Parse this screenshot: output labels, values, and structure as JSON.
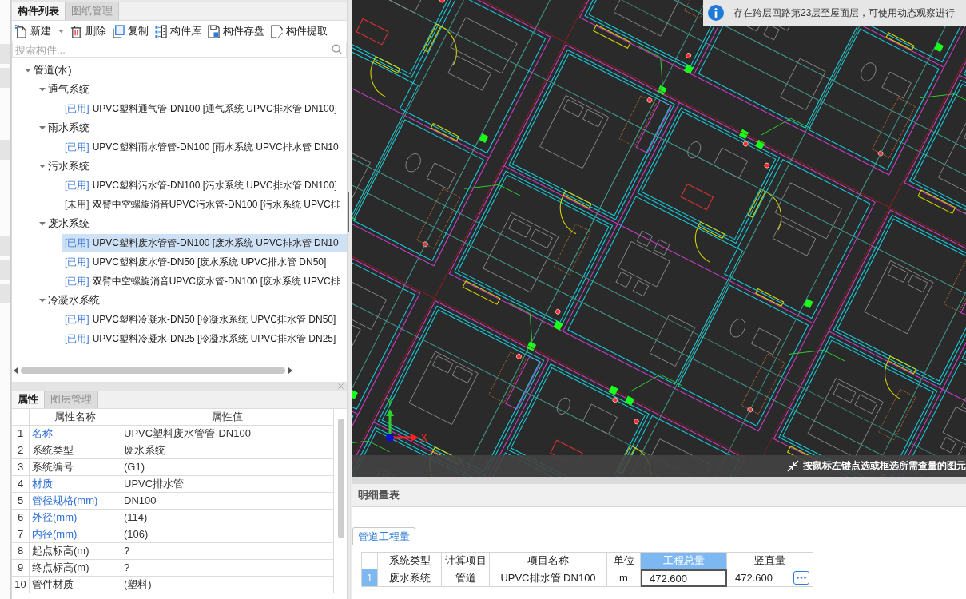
{
  "component_panel": {
    "tabs": [
      {
        "label": "构件列表",
        "selected": true
      },
      {
        "label": "图纸管理",
        "selected": false
      }
    ],
    "toolbar": [
      {
        "kind": "new",
        "label": "新建",
        "dropdown": true
      },
      {
        "kind": "delete",
        "label": "删除",
        "dropdown": false
      },
      {
        "kind": "copy",
        "label": "复制",
        "dropdown": false
      },
      {
        "kind": "library",
        "label": "构件库",
        "dropdown": false
      },
      {
        "kind": "save",
        "label": "构件存盘",
        "dropdown": false
      },
      {
        "kind": "extract",
        "label": "构件提取",
        "dropdown": false
      }
    ],
    "search": {
      "placeholder": "搜索构件..."
    },
    "tree": [
      {
        "kind": "folder",
        "label": "管道(水)",
        "expanded": true,
        "children": [
          {
            "kind": "folder",
            "label": "通气系统",
            "expanded": true,
            "children": [
              {
                "kind": "component",
                "tag": "[已用]",
                "used": true,
                "label": "UPVC塑料通气管-DN100 [通气系统 UPVC排水管 DN100]",
                "selected": false
              }
            ]
          },
          {
            "kind": "folder",
            "label": "雨水系统",
            "expanded": true,
            "children": [
              {
                "kind": "component",
                "tag": "[已用]",
                "used": true,
                "label": "UPVC塑料雨水管管-DN100 [雨水系统 UPVC排水管 DN10",
                "selected": false
              }
            ]
          },
          {
            "kind": "folder",
            "label": "污水系统",
            "expanded": true,
            "children": [
              {
                "kind": "component",
                "tag": "[已用]",
                "used": true,
                "label": "UPVC塑料污水管-DN100 [污水系统 UPVC排水管 DN100]",
                "selected": false
              },
              {
                "kind": "component",
                "tag": "[未用]",
                "used": false,
                "label": "双臂中空螺旋消音UPVC污水管-DN100 [污水系统 UPVC排",
                "selected": false
              }
            ]
          },
          {
            "kind": "folder",
            "label": "废水系统",
            "expanded": true,
            "children": [
              {
                "kind": "component",
                "tag": "[已用]",
                "used": true,
                "label": "UPVC塑料废水管管-DN100 [废水系统 UPVC排水管 DN10",
                "selected": true
              },
              {
                "kind": "component",
                "tag": "[已用]",
                "used": true,
                "label": "UPVC塑料废水管-DN50 [废水系统 UPVC排水管 DN50]",
                "selected": false
              },
              {
                "kind": "component",
                "tag": "[已用]",
                "used": true,
                "label": "双臂中空螺旋消音UPVC废水管-DN100 [废水系统 UPVC排",
                "selected": false
              }
            ]
          },
          {
            "kind": "folder",
            "label": "冷凝水系统",
            "expanded": true,
            "children": [
              {
                "kind": "component",
                "tag": "[已用]",
                "used": true,
                "label": "UPVC塑料冷凝水-DN50 [冷凝水系统 UPVC排水管 DN50]",
                "selected": false
              },
              {
                "kind": "component",
                "tag": "[已用]",
                "used": true,
                "label": "UPVC塑料冷凝水-DN25 [冷凝水系统 UPVC排水管 DN25]",
                "selected": false
              }
            ]
          }
        ]
      }
    ]
  },
  "property_panel": {
    "tabs": [
      {
        "label": "属性",
        "selected": true
      },
      {
        "label": "图层管理",
        "selected": false
      }
    ],
    "columns": [
      "属性名称",
      "属性值"
    ],
    "rows": [
      {
        "index": "1",
        "name": "名称",
        "value": "UPVC塑料废水管管-DN100",
        "public": true
      },
      {
        "index": "2",
        "name": "系统类型",
        "value": "废水系统",
        "public": false
      },
      {
        "index": "3",
        "name": "系统编号",
        "value": "(G1)",
        "public": false
      },
      {
        "index": "4",
        "name": "材质",
        "value": "UPVC排水管",
        "public": true
      },
      {
        "index": "5",
        "name": "管径规格(mm)",
        "value": "DN100",
        "public": true
      },
      {
        "index": "6",
        "name": "外径(mm)",
        "value": "(114)",
        "public": true
      },
      {
        "index": "7",
        "name": "内径(mm)",
        "value": "(106)",
        "public": true
      },
      {
        "index": "8",
        "name": "起点标高(m)",
        "value": "?",
        "public": false
      },
      {
        "index": "9",
        "name": "终点标高(m)",
        "value": "?",
        "public": false
      },
      {
        "index": "10",
        "name": "管件材质",
        "value": "(塑料)",
        "public": false
      }
    ]
  },
  "canvas": {
    "notice": "存在跨层回路第23层至屋面层，可使用动态观察进行",
    "axes": {
      "x": "X",
      "y": "Y"
    },
    "hint": "按鼠标左键点选或框选所需查量的图元"
  },
  "detail_panel": {
    "title": "明细量表",
    "tabs": [
      {
        "label": "管道工程量",
        "selected": true
      }
    ],
    "columns": [
      {
        "label": "系统类型",
        "selected": false
      },
      {
        "label": "计算项目",
        "selected": false
      },
      {
        "label": "项目名称",
        "selected": false
      },
      {
        "label": "单位",
        "selected": false
      },
      {
        "label": "工程总量",
        "selected": true
      },
      {
        "label": "竖直量",
        "selected": false
      }
    ],
    "rows": [
      {
        "index": "1",
        "selected": true,
        "cells": [
          {
            "text": "废水系统",
            "focused": false,
            "has_button": false
          },
          {
            "text": "管道",
            "focused": false,
            "has_button": false
          },
          {
            "text": "UPVC排水管 DN100",
            "focused": false,
            "has_button": false
          },
          {
            "text": "m",
            "focused": false,
            "has_button": false
          },
          {
            "text": "472.600",
            "focused": true,
            "has_button": false
          },
          {
            "text": "472.600",
            "focused": false,
            "has_button": true
          }
        ]
      }
    ]
  }
}
